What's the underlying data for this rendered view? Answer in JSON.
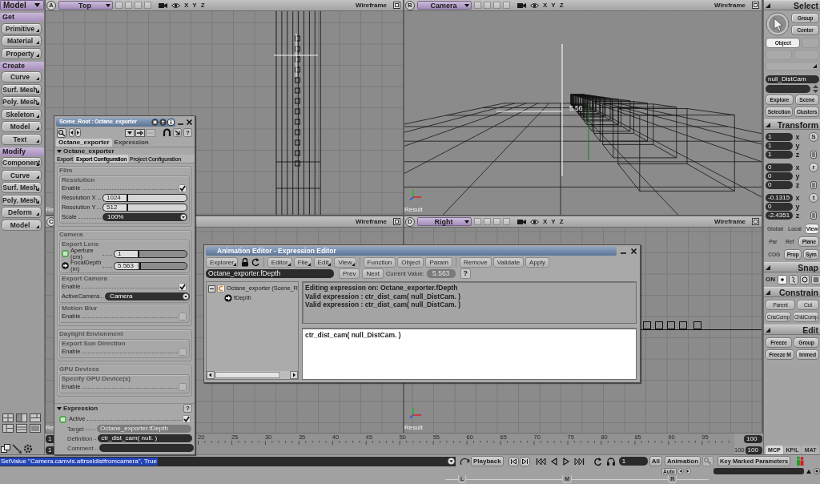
{
  "toolbar": {
    "module": "Model",
    "sections": [
      {
        "title": "Get",
        "buttons": [
          "Primitive",
          "Material",
          "Property"
        ]
      },
      {
        "title": "Create",
        "buttons": [
          "Curve",
          "Surf. Mesh",
          "Poly. Mesh",
          "Skeleton",
          "Model",
          "Text"
        ]
      },
      {
        "title": "Modify",
        "buttons": [
          "Component",
          "Curve",
          "Surf. Mesh",
          "Poly. Mesh",
          "Deform",
          "Model"
        ]
      }
    ]
  },
  "viewports": [
    {
      "letter": "A",
      "view": "Top",
      "axes": [
        "X",
        "Y",
        "Z"
      ],
      "display": "Wireframe",
      "label": "Re",
      "kind": "top"
    },
    {
      "letter": "B",
      "view": "Camera",
      "axes": [
        "X",
        "Y",
        "Z"
      ],
      "display": "Wireframe",
      "label": "Result",
      "readout": "5.56",
      "kind": "camera"
    },
    {
      "letter": "C",
      "display": "Wireframe",
      "label": "Re",
      "kind": "front"
    },
    {
      "letter": "D",
      "view": "Right",
      "axes": [
        "X",
        "Y",
        "Z"
      ],
      "display": "Wireframe",
      "label": "Result",
      "kind": "right"
    }
  ],
  "timeline": {
    "start": [
      "1",
      "1"
    ],
    "labels": [
      "20",
      "25",
      "30",
      "35",
      "40",
      "45",
      "50",
      "55",
      "60",
      "65",
      "70",
      "75",
      "80",
      "85",
      "90",
      "95"
    ],
    "range_end": "100",
    "end": [
      "100",
      "100"
    ]
  },
  "property_panel": {
    "title": "Scene_Root : Octane_exporter",
    "help": "?",
    "tabs": [
      {
        "label": "Octane_exporter",
        "selected": true
      },
      {
        "label": "Expression",
        "selected": false
      }
    ],
    "section": {
      "label": "Octane_exporter",
      "expanded": true
    },
    "subtabs": [
      {
        "label": "Export",
        "selected": false
      },
      {
        "label": "Export Configuration",
        "selected": true
      },
      {
        "label": "Project Configuration",
        "selected": false
      }
    ],
    "groups": [
      {
        "title": "Film",
        "subgroups": [
          {
            "title": "Resolution",
            "params": [
              {
                "kind": "check",
                "label": "Enable",
                "checked": true
              },
              {
                "kind": "slider",
                "label": "Resolution X",
                "value": "1024",
                "level": 0
              },
              {
                "kind": "slider",
                "label": "Resolution Y",
                "value": "512",
                "level": 0
              },
              {
                "kind": "dropdown",
                "label": "Scale",
                "value": "100%"
              }
            ]
          }
        ]
      },
      {
        "title": "Camera",
        "subgroups": [
          {
            "title": "Export Lens",
            "params": [
              {
                "kind": "slider",
                "label": "Aperture (cm)",
                "value": "1",
                "level": 0,
                "driven": false
              },
              {
                "kind": "slider",
                "label": "FocalDepth (m)",
                "value": "5.563",
                "level": 0.03,
                "driven": true
              }
            ]
          },
          {
            "title": "Export Camera",
            "params": [
              {
                "kind": "check",
                "label": "Enable",
                "checked": true
              },
              {
                "kind": "dropdown",
                "label": "ActiveCamera",
                "value": "Camera"
              }
            ]
          },
          {
            "title": "Motion Blur",
            "params": [
              {
                "kind": "check",
                "label": "Enable",
                "checked": false
              }
            ]
          }
        ]
      },
      {
        "title": "Daylight Envionment",
        "subgroups": [
          {
            "title": "Export Sun Direction",
            "params": [
              {
                "kind": "check",
                "label": "Enable",
                "checked": false
              }
            ]
          }
        ]
      },
      {
        "title": "GPU Devices",
        "subgroups": [
          {
            "title": "Specify GPU Device(s)",
            "params": [
              {
                "kind": "check",
                "label": "Enable",
                "checked": false
              }
            ]
          }
        ]
      }
    ],
    "expression": {
      "label": "Expression",
      "expanded": true,
      "help": "?",
      "active": {
        "label": "Active",
        "checked": true,
        "driven": false
      },
      "fields": [
        {
          "label": "Target",
          "value": "Octane_exporter.fDepth",
          "disabled": true
        },
        {
          "label": "Definition",
          "value": "ctr_dist_cam( null. )",
          "disabled": false
        },
        {
          "label": "Comment",
          "disabled": false
        }
      ]
    }
  },
  "expression_editor": {
    "title": "Animation Editor - Expression Editor",
    "explorer": "Explorer",
    "menus": [
      "Editor",
      "File",
      "Edit",
      "View"
    ],
    "actions": [
      "Function",
      "Object",
      "Param"
    ],
    "commands": [
      "Remove",
      "Validate",
      "Apply"
    ],
    "target": "Octane_exporter.fDepth",
    "prev": "Prev",
    "next": "Next",
    "current_label": "Current Value:",
    "current_value": "5.563",
    "help": "?",
    "tree": [
      {
        "label": "Octane_exporter (Scene_R",
        "expanded": true,
        "children": [
          {
            "label": "fDepth"
          }
        ]
      }
    ],
    "messages": [
      "Editing expression on: Octane_exporter.fDepth",
      "Valid expression : ctr_dist_cam( null_DistCam. )",
      "Valid expression : ctr_dist_cam( null_DistCam. )"
    ],
    "code": "ctr_dist_cam( null_DistCam. )"
  },
  "mcp": {
    "select": {
      "title": "Select",
      "buttons": [
        "Group",
        "Center"
      ],
      "modes": [
        {
          "label": "Object",
          "selected": true
        }
      ],
      "object": "null_DistCam",
      "nav": [
        "Explore",
        "Scene",
        "Selection",
        "Clusters"
      ]
    },
    "transform": {
      "title": "Transform",
      "groups": [
        {
          "mode": "S",
          "rows": [
            {
              "axis": "x",
              "value": "1"
            },
            {
              "axis": "y",
              "value": "1"
            },
            {
              "axis": "z",
              "value": "1"
            }
          ]
        },
        {
          "mode": "r",
          "rows": [
            {
              "axis": "x",
              "value": "0"
            },
            {
              "axis": "y",
              "value": "0"
            },
            {
              "axis": "z",
              "value": "0"
            }
          ]
        },
        {
          "mode": "t",
          "rows": [
            {
              "axis": "x",
              "value": "-0.1315"
            },
            {
              "axis": "y",
              "value": "0"
            },
            {
              "axis": "z",
              "value": "-2.4351"
            }
          ]
        }
      ],
      "options": [
        [
          {
            "label": "Global",
            "selected": false,
            "disabled": true
          },
          {
            "label": "Local",
            "selected": false,
            "disabled": true
          },
          {
            "label": "View",
            "selected": true,
            "disabled": false
          }
        ],
        [
          {
            "label": "Par",
            "selected": false,
            "disabled": true
          },
          {
            "label": "Ref",
            "selected": false,
            "disabled": true
          },
          {
            "label": "Plane",
            "selected": false,
            "disabled": false
          }
        ],
        [
          {
            "label": "COG",
            "selected": false,
            "disabled": true
          },
          {
            "label": "Prop",
            "selected": false,
            "disabled": false
          },
          {
            "label": "Sym",
            "selected": false,
            "disabled": false
          }
        ]
      ]
    },
    "snap": {
      "title": "Snap",
      "toggle": "ON"
    },
    "constrain": {
      "title": "Constrain",
      "buttons": [
        "Parent",
        "Cut",
        "CnsComp",
        "ChldComp"
      ]
    },
    "edit": {
      "title": "Edit",
      "buttons": [
        "Freeze",
        "Group",
        "Freeze M",
        "Immed"
      ]
    },
    "tabs": [
      {
        "label": "MCP",
        "selected": true
      },
      {
        "label": "KP/L",
        "selected": false
      },
      {
        "label": "MAT",
        "selected": false
      }
    ]
  },
  "status_bar": {
    "command": "SetValue \"Camera.camvis.attrseldistfromcamera\", True",
    "command_selected": true,
    "playback": "Playback",
    "frame": "1",
    "range": "All",
    "animation": "Animation",
    "auto": "Auto",
    "key_marked": "Key Marked Parameters",
    "mouse": [
      "L",
      "M",
      "R"
    ]
  }
}
